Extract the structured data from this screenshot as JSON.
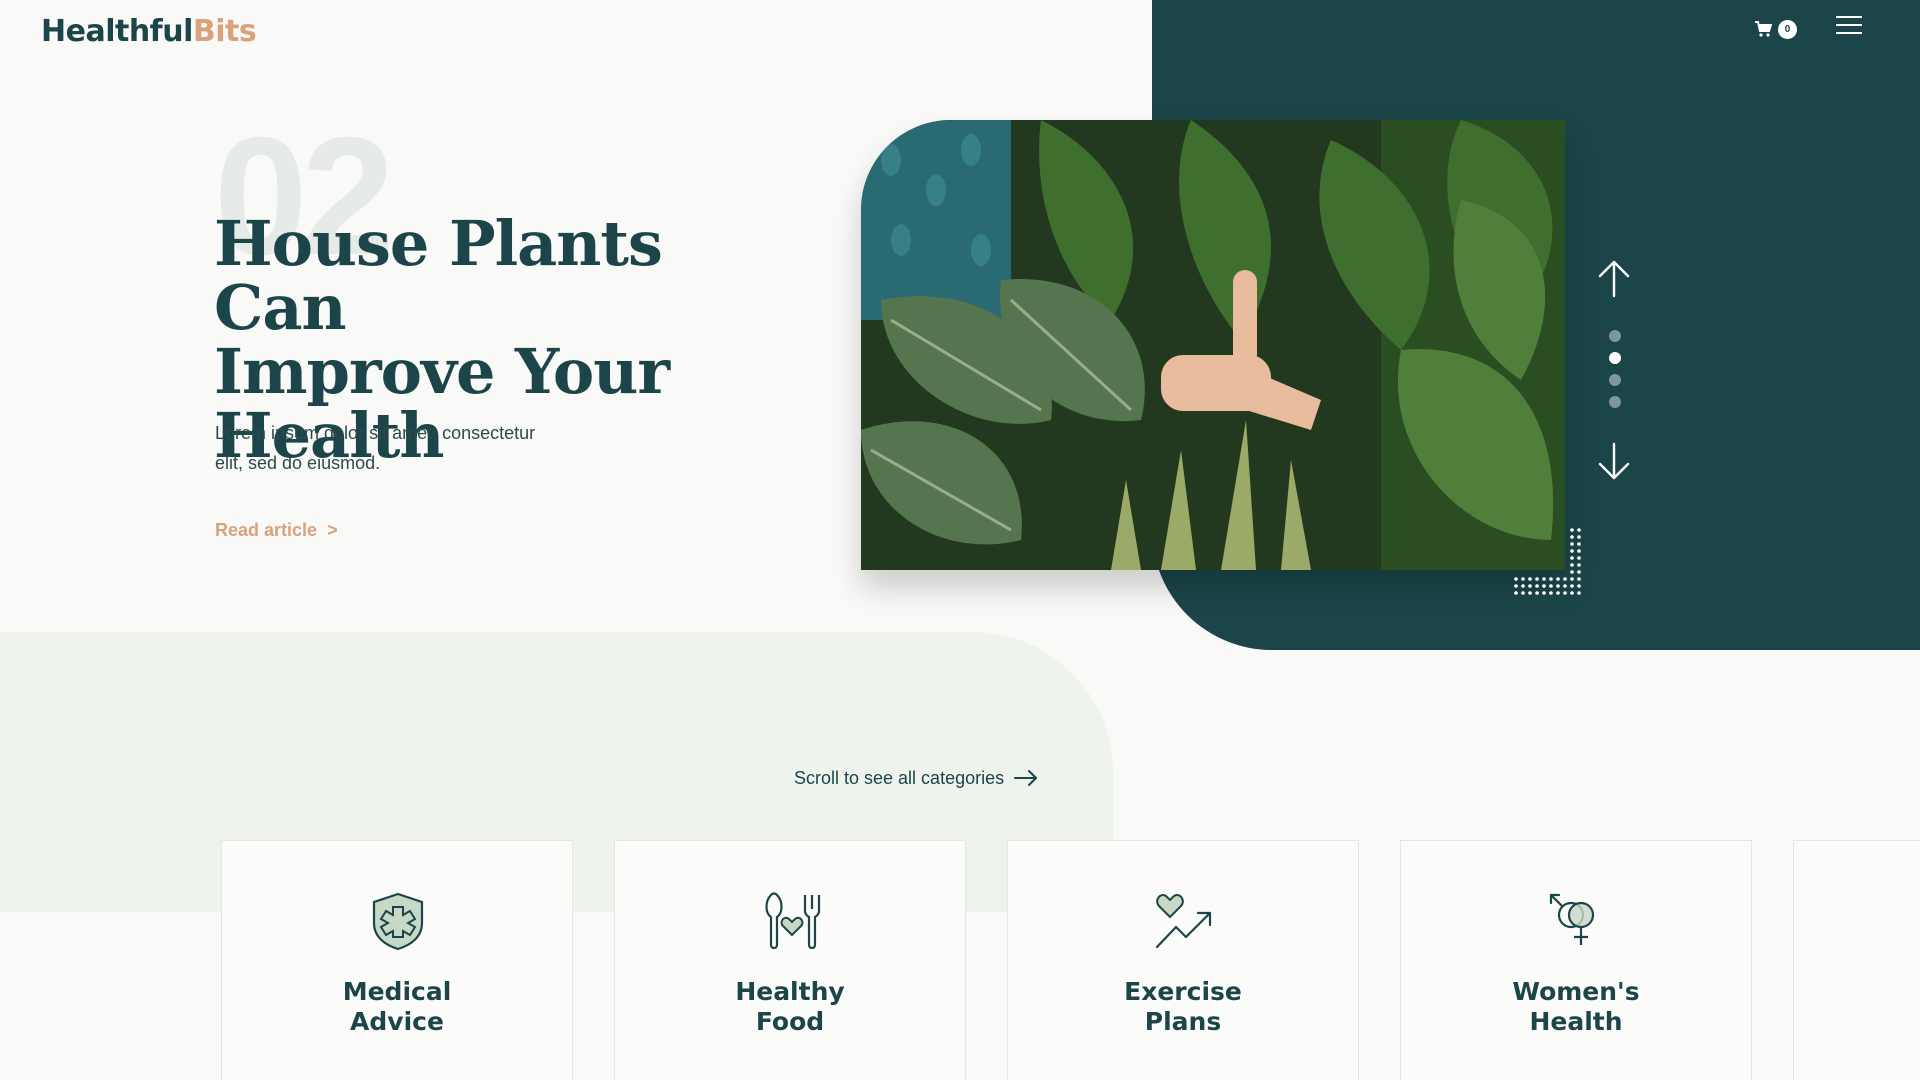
{
  "brand": {
    "part1": "Healthful",
    "part2": "Bits"
  },
  "header": {
    "cart_count": "0"
  },
  "hero": {
    "number": "02",
    "title_lines": [
      "House Plants Can",
      "Improve Your",
      "Health"
    ],
    "description_lines": [
      "Lorem ipsum dolor sit amet, consectetur",
      "elit, sed do eiusmod."
    ],
    "read_link": "Read article",
    "read_link_arrow": ">",
    "slide_count": 4,
    "active_slide": 2
  },
  "categories": {
    "scroll_hint": "Scroll to see all categories",
    "items": [
      {
        "line1": "Medical",
        "line2": "Advice",
        "icon": "shield-medical-icon"
      },
      {
        "line1": "Healthy",
        "line2": "Food",
        "icon": "cutlery-heart-icon"
      },
      {
        "line1": "Exercise",
        "line2": "Plans",
        "icon": "heart-trend-icon"
      },
      {
        "line1": "Women's",
        "line2": "Health",
        "icon": "gender-icon"
      }
    ]
  },
  "colors": {
    "teal": "#1b4548",
    "accent": "#d9a27d",
    "mint": "#eff3ee",
    "background": "#f9f9f7"
  }
}
